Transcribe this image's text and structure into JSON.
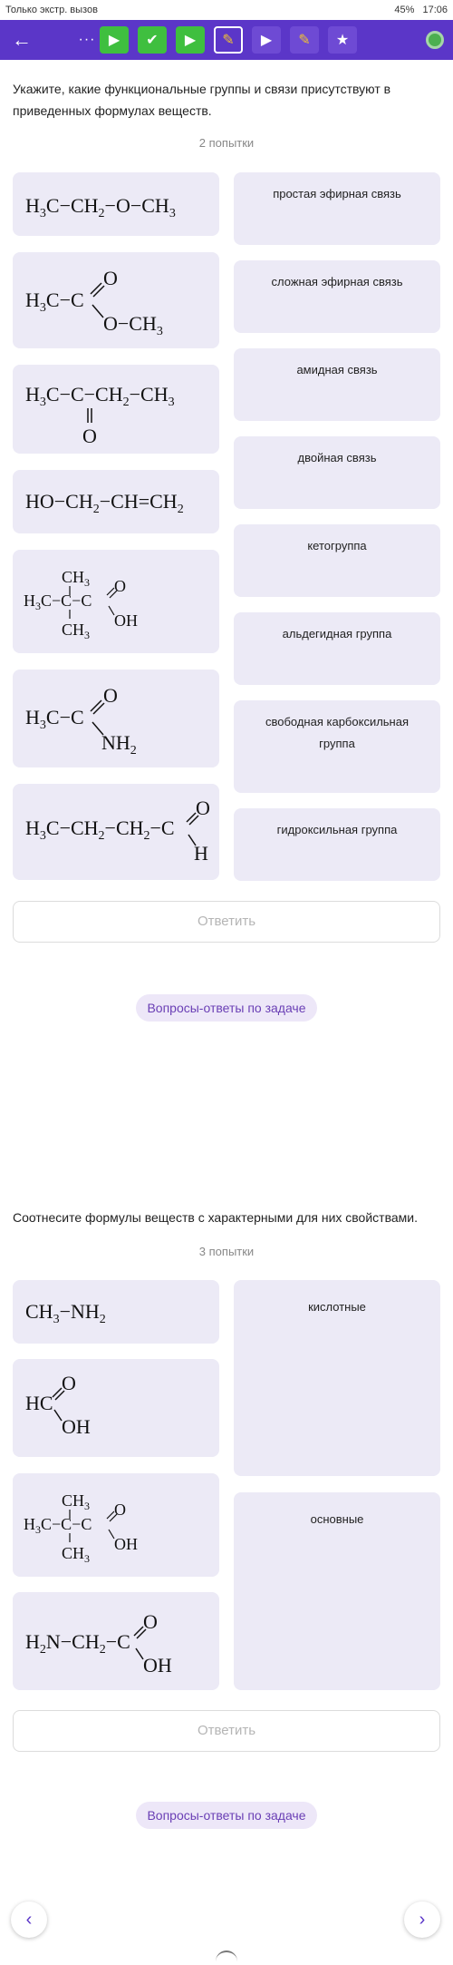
{
  "status_bar": {
    "left_text": "Только экстр. вызов",
    "battery": "45%",
    "time": "17:06"
  },
  "toolbar": {
    "back_icon": "arrow-left-icon",
    "more_icon": "more-dots-icon",
    "dots": "···"
  },
  "task1": {
    "question": "Укажите, какие функциональные группы и связи присутствуют в приведенных формулах веществ.",
    "attempts": "2 попытки",
    "formulas": [
      {
        "text": "H₃C–CH₂–O–CH₃"
      },
      {
        "text": "H₃C–C(=O)–O–CH₃"
      },
      {
        "text": "H₃C–C(=O)–CH₂–CH₃"
      },
      {
        "text": "HO–CH₂–CH=CH₂"
      },
      {
        "text": "H₃C–C(CH₃)₂–C(=O)OH"
      },
      {
        "text": "H₃C–C(=O)NH₂"
      },
      {
        "text": "H₃C–CH₂–CH₂–C(=O)H"
      }
    ],
    "answers": [
      "простая эфирная связь",
      "сложная эфирная связь",
      "амидная связь",
      "двойная связь",
      "кетогруппа",
      "альдегидная группа",
      "свободная карбоксильная группа",
      "гидроксильная группа"
    ],
    "submit_label": "Ответить",
    "qa_label": "Вопросы-ответы по задаче"
  },
  "task2": {
    "question": "Соотнесите формулы веществ с характерными для них свойствами.",
    "attempts": "3 попытки",
    "formulas": [
      {
        "text": "CH₃–NH₂"
      },
      {
        "text": "HC(=O)OH"
      },
      {
        "text": "H₃C–C(CH₃)₂–C(=O)OH"
      },
      {
        "text": "H₂N–CH₂–C(=O)OH"
      }
    ],
    "answers": [
      "кислотные",
      "основные"
    ],
    "submit_label": "Ответить",
    "qa_label": "Вопросы-ответы по задаче"
  },
  "nav": {
    "prev_icon": "chevron-left-icon",
    "next_icon": "chevron-right-icon"
  }
}
